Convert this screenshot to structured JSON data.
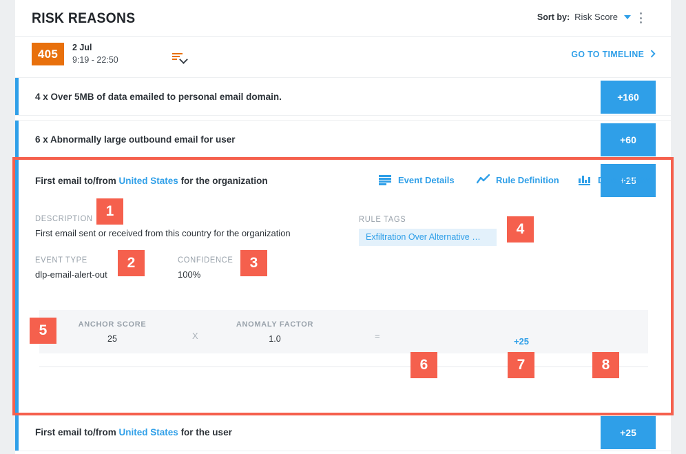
{
  "header": {
    "title": "RISK REASONS",
    "sort_label": "Sort by:",
    "sort_value": "Risk Score",
    "menu_icon": "kebab-menu-icon"
  },
  "summary": {
    "score": "405",
    "date": "2 Jul",
    "time_range": "9:19 - 22:50",
    "filter_icon": "sort-filter-icon",
    "timeline_link": "GO TO TIMELINE"
  },
  "rows": [
    {
      "text_prefix": "4 x Over 5MB of data emailed to personal email domain.",
      "country": "",
      "text_suffix": "",
      "points": "+160"
    },
    {
      "text_prefix": "6 x Abnormally large outbound email for user",
      "country": "",
      "text_suffix": "",
      "points": "+60"
    },
    {
      "text_prefix": "First email to/from ",
      "country": "United States",
      "text_suffix": " for the organization",
      "points": "+25"
    },
    {
      "text_prefix": "First email to/from ",
      "country": "United States",
      "text_suffix": " for the user",
      "points": "+25"
    }
  ],
  "detail": {
    "description_label": "DESCRIPTION",
    "description_value": "First email sent or received from this country for the organization",
    "event_type_label": "EVENT TYPE",
    "event_type_value": "dlp-email-alert-out",
    "confidence_label": "CONFIDENCE",
    "confidence_value": "100%",
    "rule_tags_label": "RULE TAGS",
    "rule_tag_value": "Exfiltration Over Alternative …",
    "score_strip": {
      "anchor_label": "ANCHOR SCORE",
      "anchor_value": "25",
      "operator_multiply": "X",
      "anomaly_label": "ANOMALY FACTOR",
      "anomaly_value": "1.0",
      "operator_equals": "=",
      "result_value": "+25"
    },
    "actions": [
      {
        "label": "Event Details",
        "icon": "list-lines-icon"
      },
      {
        "label": "Rule Definition",
        "icon": "line-chart-icon"
      },
      {
        "label": "Data Insight",
        "icon": "bar-chart-icon"
      }
    ]
  },
  "annotations": {
    "n1": "1",
    "n2": "2",
    "n3": "3",
    "n4": "4",
    "n5": "5",
    "n6": "6",
    "n7": "7",
    "n8": "8"
  },
  "colors": {
    "accent_blue": "#2f9fe8",
    "score_orange": "#e8700c",
    "annotation_red": "#f5604d",
    "page_bg": "#edeff1"
  }
}
